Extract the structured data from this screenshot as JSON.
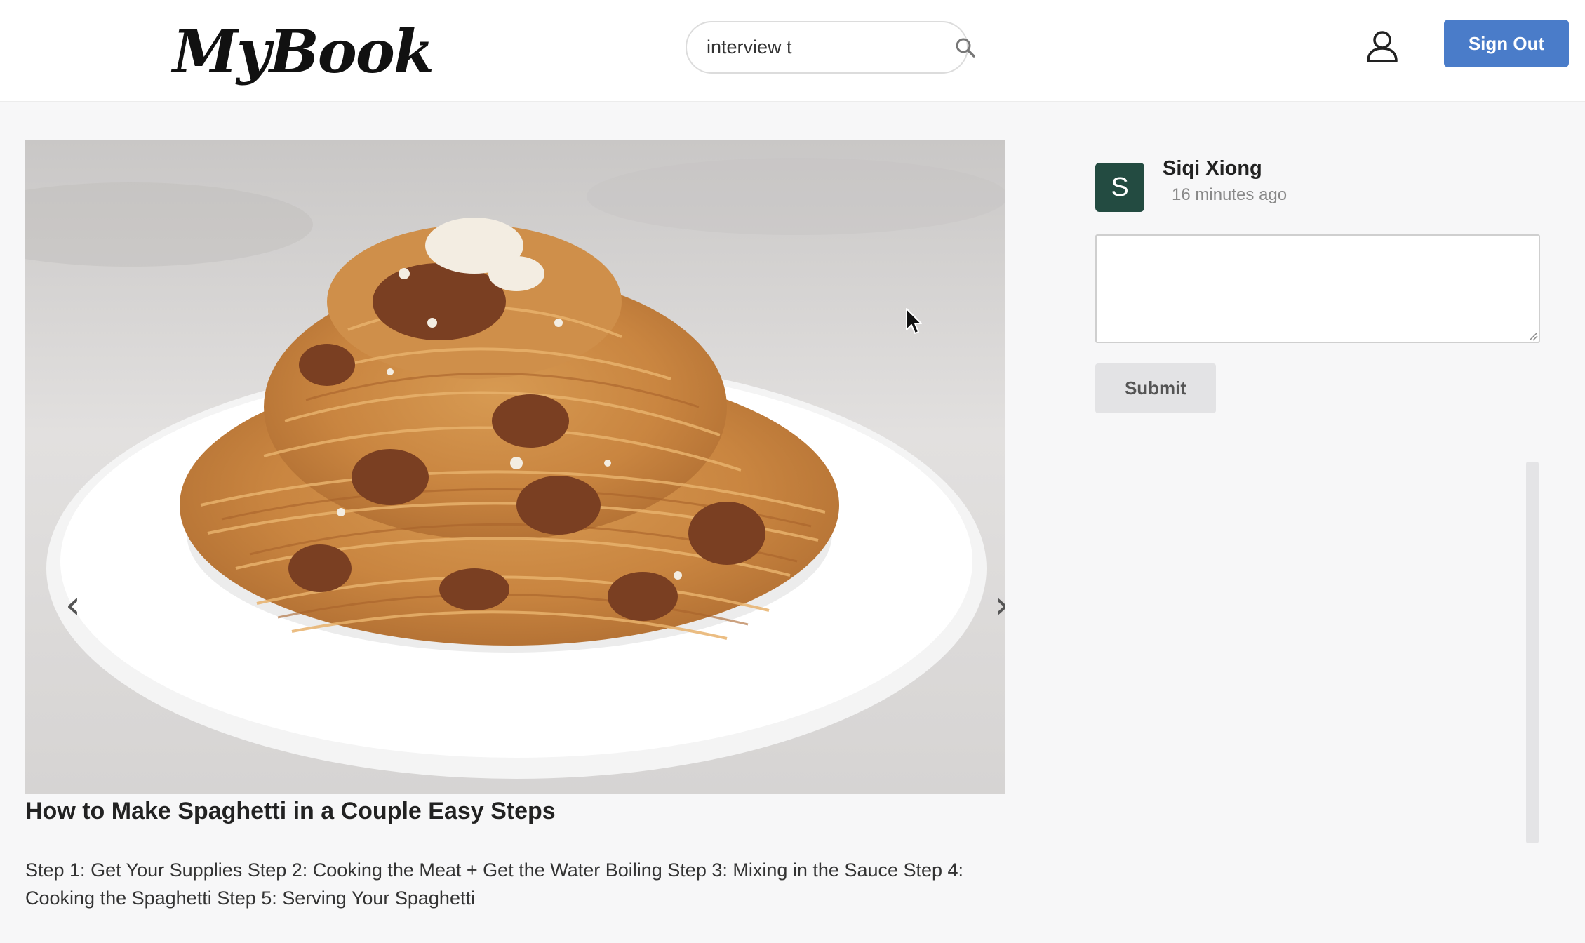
{
  "header": {
    "logo": "MyBook",
    "search": {
      "value": "interview t",
      "placeholder": "Search"
    },
    "sign_out_label": "Sign Out"
  },
  "post": {
    "title": "How to Make Spaghetti in a Couple Easy Steps",
    "body": "Step 1: Get Your Supplies Step 2: Cooking the Meat + Get the Water Boiling Step 3: Mixing in the Sauce Step 4: Cooking the Spaghetti Step 5: Serving Your Spaghetti",
    "carousel": {
      "prev_glyph": "‹",
      "next_glyph": "›"
    }
  },
  "comment": {
    "avatar_initial": "S",
    "user_name": "Siqi Xiong",
    "timestamp": "16 minutes ago",
    "submit_label": "Submit"
  },
  "colors": {
    "accent": "#4a7cc9",
    "avatar_bg": "#234b41",
    "submit_bg": "#e3e3e5"
  },
  "icons": {
    "search": "search-icon",
    "user": "user-icon",
    "prev": "chevron-left-icon",
    "next": "chevron-right-icon",
    "cursor": "mouse-cursor-icon"
  }
}
